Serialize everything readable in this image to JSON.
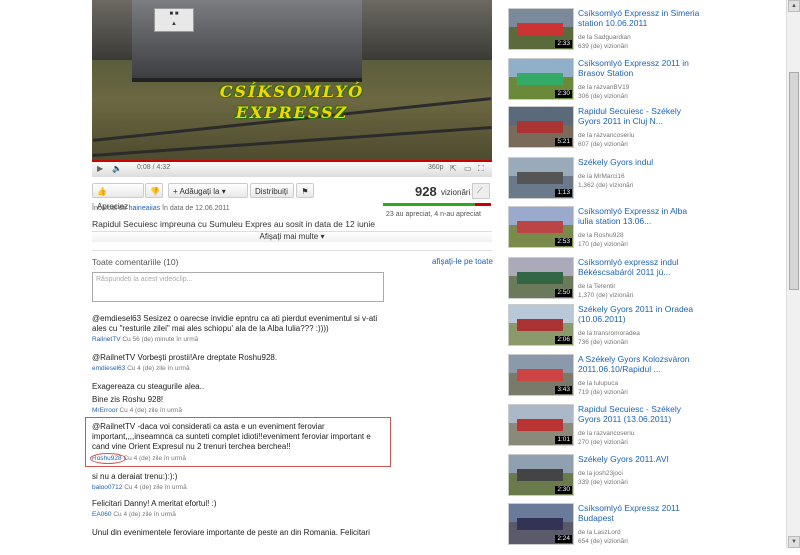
{
  "video": {
    "overlay_title_line1": "CSÍKSOMLYÓ",
    "overlay_title_line2": "EXPRESSZ",
    "time": "0:08 / 4:32",
    "quality": "360p"
  },
  "actions": {
    "like_label": "Apreciez",
    "add_label": "Adăugați la",
    "share_label": "Distribuiți",
    "views_count": "928",
    "views_label": "vizionări"
  },
  "rating": {
    "text": "23 au apreciat, 4 n-au apreciat",
    "like_fraction": 0.85
  },
  "uploaded": {
    "prefix": "Încărcat de",
    "user": "haineaiias",
    "suffix": "în data de 12.06.2011"
  },
  "description": "Rapidul Secuiesc impreuna cu Sumuleu Expres au sosit in data de 12 iunie",
  "show_more": "Afișați mai multe",
  "comments": {
    "header": "Toate comentariile (10)",
    "show_all": "afișați-le pe toate",
    "reply_placeholder": "Răspundeți la acest videoclip...",
    "items": [
      {
        "text": "@emdiesel63 Sesizez o oarecse invidie epntru ca ati pierdut evenimentul si v-ati ales cu \"resturile zilei\" mai ales schiopu' ala de la Alba Iulia??? :))))",
        "user": "RailnetTV",
        "meta": "Cu 56 (de) minute în urmă"
      },
      {
        "text": "@RailnetTV Vorbești prostii!Are dreptate Roshu928.",
        "user": "emdiesel63",
        "meta": "Cu 4 (de) zile în urmă"
      },
      {
        "text": "Exagereaza cu steagurile alea..",
        "text2": "Bine zis Roshu 928!",
        "user": "MrErroor",
        "meta": "Cu 4 (de) zile în urmă"
      },
      {
        "text": "@RailnetTV -daca voi considerati ca asta e un eveniment feroviar important,,,,inseamnca ca sunteti complet idioti!!eveniment feroviar important e cand vine Orient Expresul nu 2 trenuri terchea berchea!!",
        "user": "Roshu928",
        "meta": "Cu 4 (de) zile în urmă"
      },
      {
        "text": "si nu a deraiat trenu:):):)",
        "user": "baloo0712",
        "meta": "Cu 4 (de) zile în urmă"
      },
      {
        "text": "Felicitari Danny! A meritat efortul! :)",
        "user": "EA060",
        "meta": "Cu 4 (de) zile în urmă"
      },
      {
        "text": "Unul din evenimentele feroviare importante de peste an din Romania. Felicitari"
      }
    ]
  },
  "related": [
    {
      "title": "Csíksomlyó Expressz in Simeria station 10.06.2011",
      "by": "de la",
      "user": "Sadguardian",
      "views": "639 (de) vizionări",
      "duration": "2:33"
    },
    {
      "title": "Csíksomlyó Expressz 2011 in Brasov Station",
      "by": "de la",
      "user": "razvanBV19",
      "views": "306 (de) vizionări",
      "duration": "2:30"
    },
    {
      "title": "Rapidul Secuiesc - Székely Gyors 2011 in Cluj N...",
      "by": "de la",
      "user": "razvancoseriu",
      "views": "607 (de) vizionări",
      "duration": "5:21"
    },
    {
      "title": "Székely Gyors indul",
      "by": "de la",
      "user": "MrMarci16",
      "views": "1,362 (de) vizionări",
      "duration": "1:13"
    },
    {
      "title": "Csíksomlyó Expressz in Alba iulia station 13.06...",
      "by": "de la",
      "user": "Roshu928",
      "views": "170 (de) vizionări",
      "duration": "2:53"
    },
    {
      "title": "Csíksomlyó expressz indul Békéscsabáról 2011 jú...",
      "by": "de la",
      "user": "Terentir",
      "views": "1,370 (de) vizionări",
      "duration": "2:50"
    },
    {
      "title": "Székely Gyors 2011 in Oradea (10.06.2011)",
      "by": "de la",
      "user": "transromoradea",
      "views": "736 (de) vizionări",
      "duration": "2:06"
    },
    {
      "title": "A Székely Gyors Kolozsváron 2011.06.10/Rapidul ...",
      "by": "de la",
      "user": "lulupuca",
      "views": "719 (de) vizionări",
      "duration": "3:43"
    },
    {
      "title": "Rapidul Secuiesc - Székely Gyors 2011 (13.06.2011)",
      "by": "de la",
      "user": "razvancoseriu",
      "views": "270 (de) vizionări",
      "duration": "1:01"
    },
    {
      "title": "Székely Gyors 2011.AVI",
      "by": "de la",
      "user": "josh23joci",
      "views": "339 (de) vizionări",
      "duration": "2:30"
    },
    {
      "title": "Csíksomlyó Expressz 2011 Budapest",
      "by": "de la",
      "user": "LaszLord",
      "views": "654 (de) vizionări",
      "duration": "2:24"
    }
  ],
  "colors": {
    "accent_red": "#cc0000",
    "link_blue": "#1c62b9",
    "like_green": "#2fa91f",
    "highlight_red": "#d9534f"
  }
}
